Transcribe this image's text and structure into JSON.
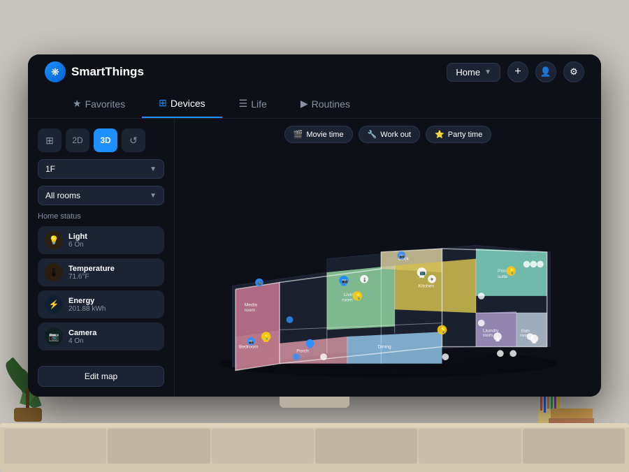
{
  "app": {
    "name": "SmartThings",
    "logo_symbol": "❋"
  },
  "header": {
    "home_label": "Home",
    "add_label": "+",
    "profile_icon": "person",
    "settings_icon": "gear"
  },
  "nav": {
    "tabs": [
      {
        "id": "favorites",
        "label": "Favorites",
        "icon": "★",
        "active": false
      },
      {
        "id": "devices",
        "label": "Devices",
        "icon": "⊞",
        "active": true
      },
      {
        "id": "life",
        "label": "Life",
        "icon": "☰",
        "active": false
      },
      {
        "id": "routines",
        "label": "Routines",
        "icon": "▶",
        "active": false
      }
    ]
  },
  "sidebar": {
    "view_controls": [
      {
        "id": "grid",
        "label": "⊞",
        "active": false
      },
      {
        "id": "2d",
        "label": "2D",
        "active": false
      },
      {
        "id": "3d",
        "label": "3D",
        "active": true
      },
      {
        "id": "history",
        "label": "↺",
        "active": false
      }
    ],
    "floor": "1F",
    "room": "All rooms",
    "home_status_title": "Home status",
    "status_items": [
      {
        "id": "light",
        "icon": "💡",
        "label": "Light",
        "value": "6 On",
        "type": "yellow"
      },
      {
        "id": "temperature",
        "icon": "🌡",
        "label": "Temperature",
        "value": "71.6°F",
        "type": "orange"
      },
      {
        "id": "energy",
        "icon": "⚡",
        "label": "Energy",
        "value": "201.88 kWh",
        "type": "blue"
      },
      {
        "id": "camera",
        "icon": "📷",
        "label": "Camera",
        "value": "4 On",
        "type": "teal"
      }
    ],
    "edit_map_btn": "Edit map"
  },
  "scenes": [
    {
      "id": "movie",
      "icon": "🎬",
      "label": "Movie time"
    },
    {
      "id": "workout",
      "icon": "🔧",
      "label": "Work out"
    },
    {
      "id": "party",
      "icon": "⭐",
      "label": "Party time"
    }
  ],
  "colors": {
    "accent": "#1e90ff",
    "bg_dark": "#0d1117",
    "bg_card": "#1c2333",
    "text_primary": "#ffffff",
    "text_secondary": "#8892a4"
  }
}
